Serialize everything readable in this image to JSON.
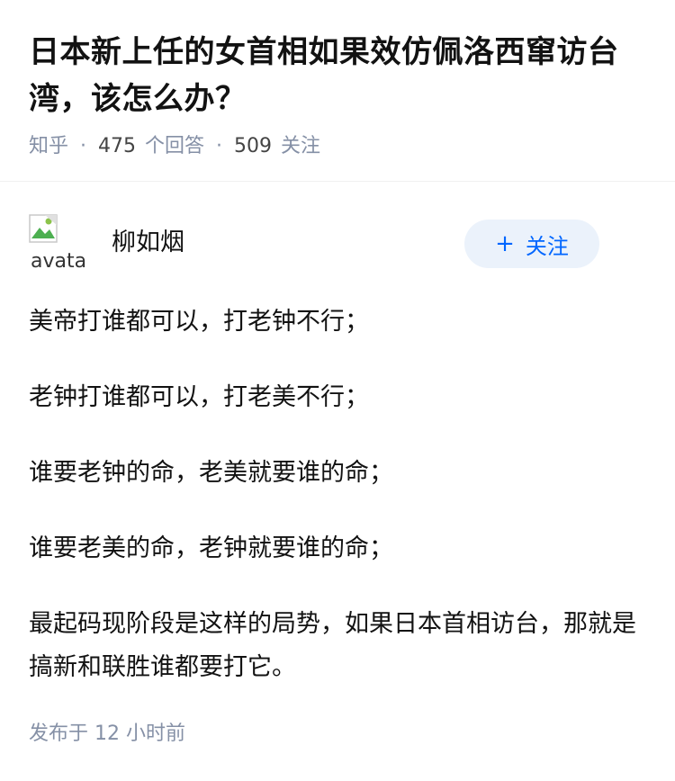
{
  "question": {
    "title": "日本新上任的女首相如果效仿佩洛西窜访台湾，该怎么办？",
    "source": "知乎",
    "answer_count": "475",
    "answer_label": "个回答",
    "follow_count": "509",
    "follow_label": "关注"
  },
  "answer": {
    "author": {
      "name": "柳如烟",
      "avatar_alt": "avatar"
    },
    "follow_button": {
      "icon": "+",
      "label": "关注"
    },
    "paragraphs": [
      "美帝打谁都可以，打老钟不行；",
      "老钟打谁都可以，打老美不行；",
      "谁要老钟的命，老美就要谁的命；",
      "谁要老美的命，老钟就要谁的命；",
      "最起码现阶段是这样的局势，如果日本首相访台，那就是搞新和联胜谁都要打它。"
    ],
    "published": "发布于  12 小时前"
  },
  "colors": {
    "accent": "#0066ff",
    "accent_bg": "#ebf2fb",
    "meta": "#8590a6",
    "text": "#121212"
  }
}
